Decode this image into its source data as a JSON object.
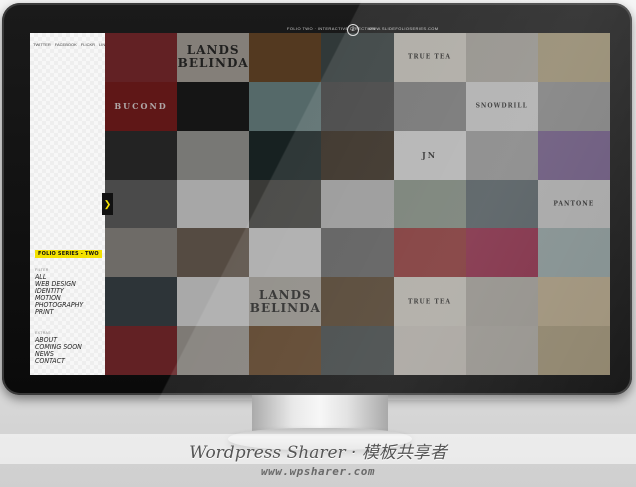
{
  "topbar": {
    "left_text": "FOLIO TWO · INTERACTIVE DIRECTION",
    "logo_text": "2",
    "right_text": "WWW.SLIDEFOLIOSERIES.COM"
  },
  "sidebar": {
    "social": [
      "TWITTER",
      "FACEBOOK",
      "FLICKR",
      "LINKEDIN"
    ],
    "brand": "FOLIO SERIES - TWO",
    "filter_heading": "FILTER",
    "filters": [
      "ALL",
      "WEB DESIGN",
      "IDENTITY",
      "MOTION",
      "PHOTOGRAPHY",
      "PRINT"
    ],
    "extras_heading": "EXTRAS",
    "extras": [
      "ABOUT",
      "COMING SOON",
      "NEWS",
      "CONTACT"
    ]
  },
  "tiles": [
    {
      "bg": "#7e2b2f",
      "label": ""
    },
    {
      "bg": "#a9a39c",
      "label": "LANDS BELINDA",
      "style": "serif"
    },
    {
      "bg": "#6b4a2a",
      "label": ""
    },
    {
      "bg": "#3f4a4a",
      "label": ""
    },
    {
      "bg": "#d9d5cc",
      "label": "TRUE TEA",
      "style": "tiny"
    },
    {
      "bg": "#b7b3ab",
      "label": ""
    },
    {
      "bg": "#b8a987",
      "label": ""
    },
    {
      "bg": "#7a1e1e",
      "label": "BUCOND",
      "style": "small-light"
    },
    {
      "bg": "#1b1b1b",
      "label": ""
    },
    {
      "bg": "#6d8787",
      "label": ""
    },
    {
      "bg": "#4d4d4d",
      "label": ""
    },
    {
      "bg": "#8c8c8c",
      "label": ""
    },
    {
      "bg": "#dcdcdc",
      "label": "SNOWDRILL",
      "style": "tiny"
    },
    {
      "bg": "#9c9c9c",
      "label": ""
    },
    {
      "bg": "#2e2e2e",
      "label": ""
    },
    {
      "bg": "#9a9a96",
      "label": ""
    },
    {
      "bg": "#1e2b2b",
      "label": ""
    },
    {
      "bg": "#3c3023",
      "label": ""
    },
    {
      "bg": "#e0e0e0",
      "label": "JN",
      "style": "small"
    },
    {
      "bg": "#a6a6a6",
      "label": ""
    },
    {
      "bg": "#7d6595",
      "label": ""
    },
    {
      "bg": "#5f5f5f",
      "label": ""
    },
    {
      "bg": "#d6d6d6",
      "label": ""
    },
    {
      "bg": "#4b4b47",
      "label": ""
    },
    {
      "bg": "#bdbdbd",
      "label": ""
    },
    {
      "bg": "#8f9a8d",
      "label": ""
    },
    {
      "bg": "#5f6b70",
      "label": ""
    },
    {
      "bg": "#cfcfcf",
      "label": "PANTONE",
      "style": "tiny"
    },
    {
      "bg": "#8e8a85",
      "label": ""
    },
    {
      "bg": "#6e6155",
      "label": ""
    },
    {
      "bg": "#d8d8d8",
      "label": ""
    },
    {
      "bg": "#6c6c6c",
      "label": ""
    },
    {
      "bg": "#9a3b3b",
      "label": ""
    },
    {
      "bg": "#9c2d4e",
      "label": ""
    },
    {
      "bg": "#9fb0b0",
      "label": ""
    },
    {
      "bg": "#3a4348",
      "label": ""
    },
    {
      "bg": "#d9d9d9",
      "label": ""
    },
    {
      "bg": "#b0aca4",
      "label": "LANDS BELINDA",
      "style": "serif"
    },
    {
      "bg": "#5e4a33",
      "label": ""
    },
    {
      "bg": "#d9d5cc",
      "label": "TRUE TEA",
      "style": "tiny"
    },
    {
      "bg": "#b5b1a9",
      "label": ""
    },
    {
      "bg": "#c4b494",
      "label": ""
    },
    {
      "bg": "#7e2b2f",
      "label": ""
    },
    {
      "bg": "#a29d96",
      "label": ""
    },
    {
      "bg": "#6b4a2a",
      "label": ""
    },
    {
      "bg": "#4a5050",
      "label": ""
    },
    {
      "bg": "#d2cec6",
      "label": ""
    },
    {
      "bg": "#b9b5ad",
      "label": ""
    },
    {
      "bg": "#b0a282",
      "label": ""
    }
  ],
  "watermark": {
    "brand_text": "Wordpress Sharer · 模板共享者",
    "url": "www.wpsharer.com"
  }
}
